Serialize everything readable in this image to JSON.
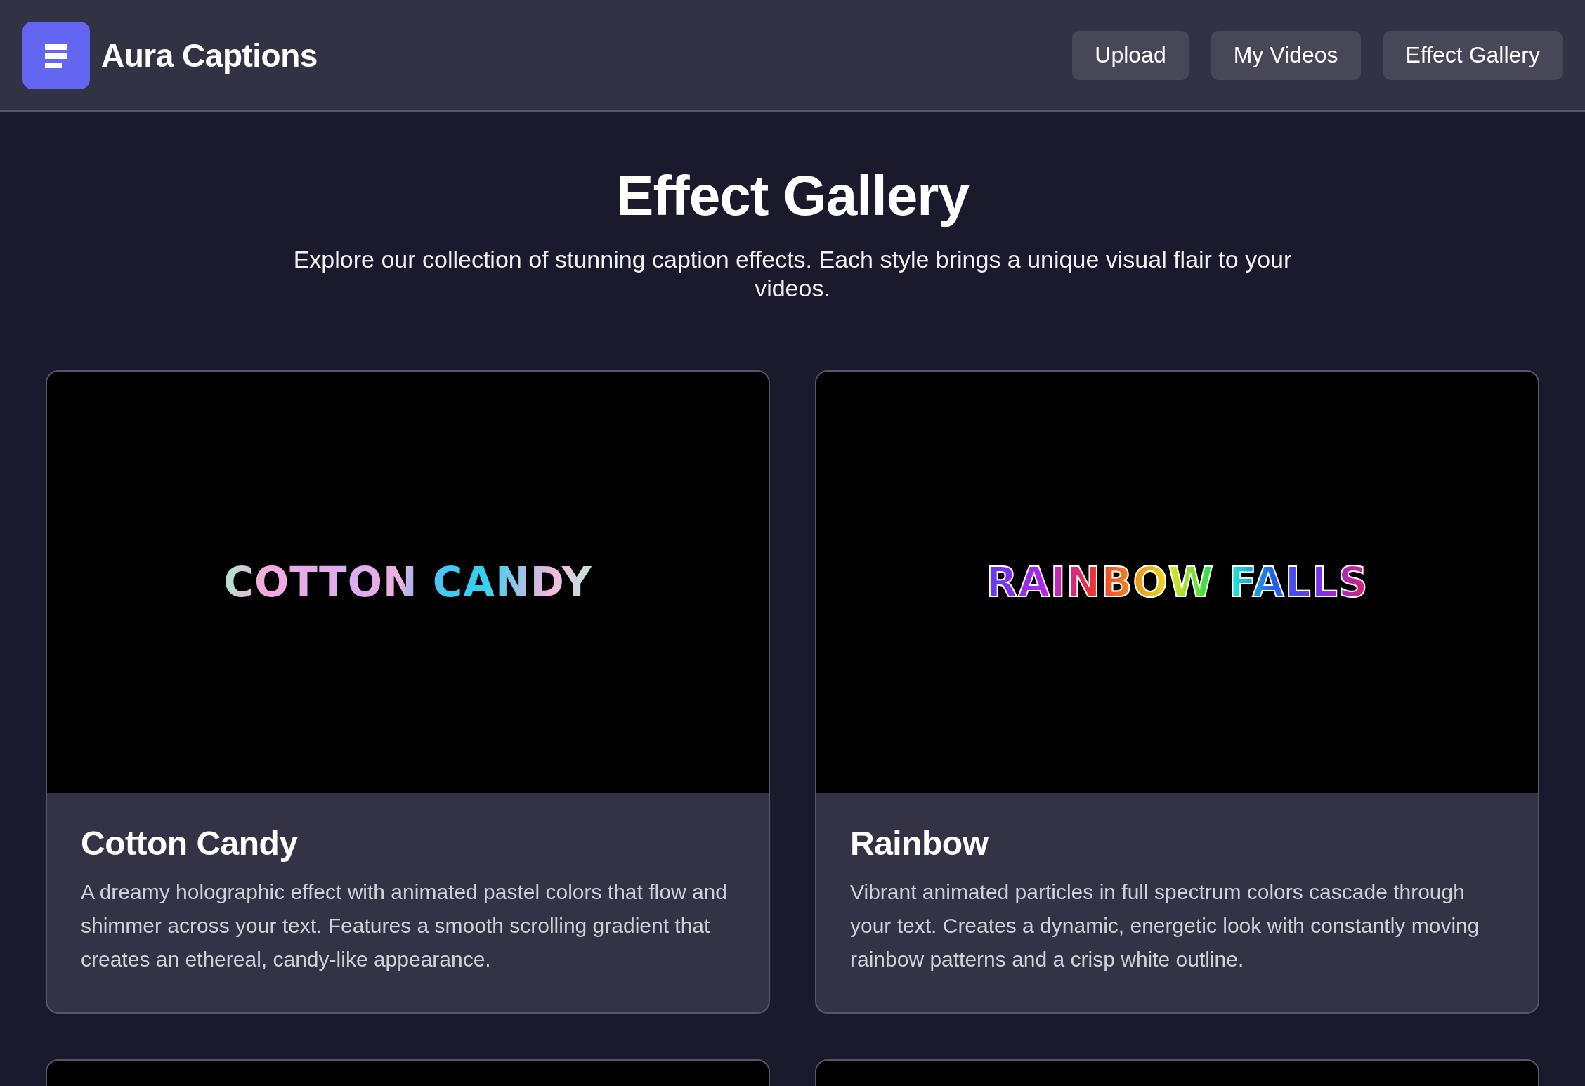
{
  "header": {
    "brand": "Aura Captions",
    "nav": [
      {
        "label": "Upload"
      },
      {
        "label": "My Videos"
      },
      {
        "label": "Effect Gallery"
      }
    ]
  },
  "page": {
    "title": "Effect Gallery",
    "subtitle": "Explore our collection of stunning caption effects. Each style brings a unique visual flair to your videos."
  },
  "effects": [
    {
      "kind": "pastel",
      "preview_caption": "COTTON CANDY",
      "name": "Cotton Candy",
      "description": "A dreamy holographic effect with animated pastel colors that flow and shimmer across your text. Features a smooth scrolling gradient that creates an ethereal, candy-like appearance."
    },
    {
      "kind": "rainbow",
      "preview_caption": "RAINBOW FALLS",
      "name": "Rainbow",
      "description": "Vibrant animated particles in full spectrum colors cascade through your text. Creates a dynamic, energetic look with constantly moving rainbow patterns and a crisp white outline."
    }
  ]
}
